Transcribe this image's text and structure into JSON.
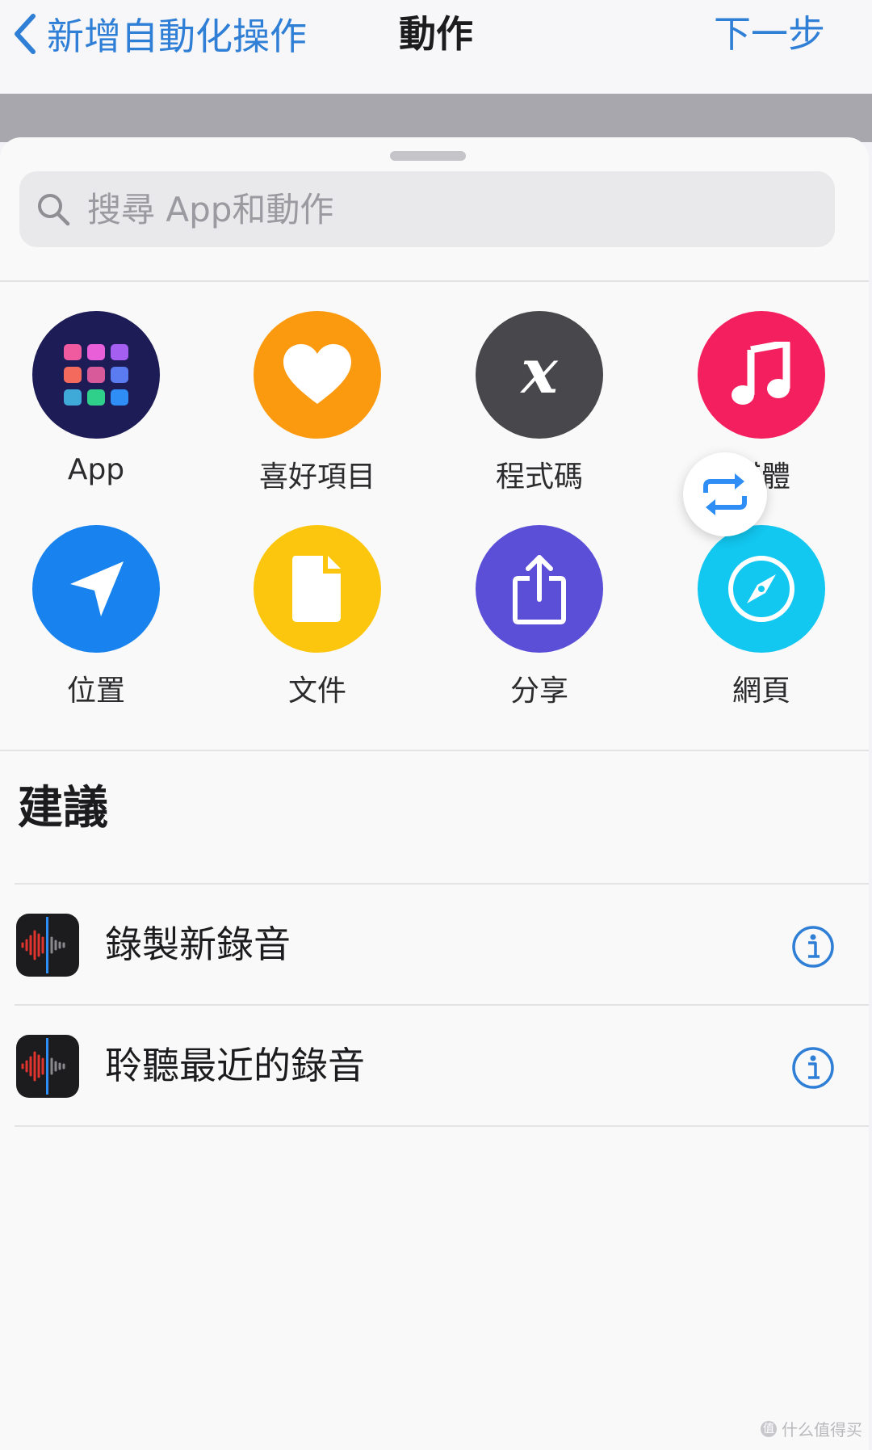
{
  "navbar": {
    "back_label": "新增自動化操作",
    "title": "動作",
    "next_label": "下一步"
  },
  "search": {
    "placeholder": "搜尋 App和動作",
    "value": ""
  },
  "categories": [
    {
      "label": "App",
      "icon": "app-grid-icon",
      "color": "#1e1c57"
    },
    {
      "label": "喜好項目",
      "icon": "heart-icon",
      "color": "#fb9a0f"
    },
    {
      "label": "程式碼",
      "icon": "variable-x-icon",
      "color": "#48484c"
    },
    {
      "label": "媒體",
      "icon": "music-note-icon",
      "color": "#f41f5e"
    },
    {
      "label": "位置",
      "icon": "location-arrow-icon",
      "color": "#1883ef"
    },
    {
      "label": "文件",
      "icon": "document-icon",
      "color": "#fdc60e"
    },
    {
      "label": "分享",
      "icon": "share-icon",
      "color": "#5b4fd8"
    },
    {
      "label": "網頁",
      "icon": "compass-icon",
      "color": "#12c7f0"
    }
  ],
  "suggestions": {
    "title": "建議",
    "items": [
      {
        "label": "錄製新錄音",
        "icon": "voice-memos-icon"
      },
      {
        "label": "聆聽最近的錄音",
        "icon": "voice-memos-icon"
      }
    ]
  },
  "floating_button": {
    "icon": "repeat-arrows-icon"
  },
  "watermark": {
    "text": "什么值得买"
  },
  "colors": {
    "accent": "#2f7fd6",
    "sheet": "#f9f9f9"
  }
}
